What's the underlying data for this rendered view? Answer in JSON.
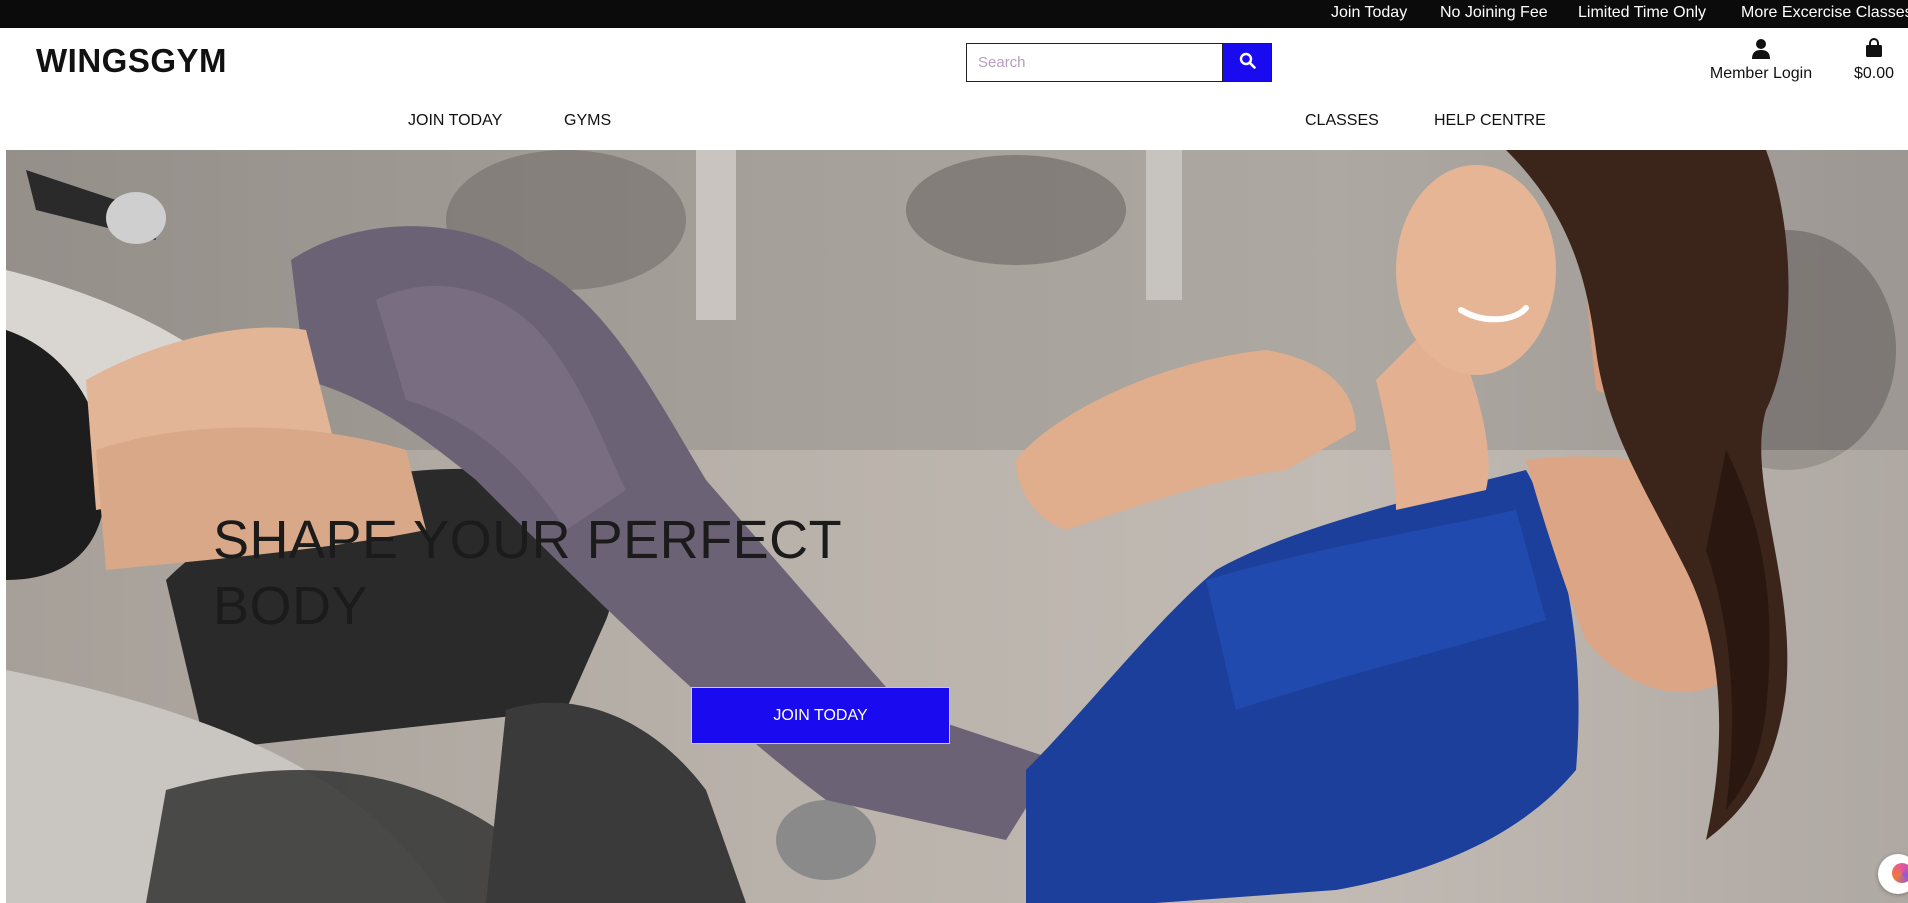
{
  "promo_bar": {
    "items": [
      "Join Today",
      "No Joining Fee",
      "Limited Time Only",
      "More Excercise Classes"
    ]
  },
  "header": {
    "brand": "WINGSGYM",
    "search": {
      "placeholder": "Search",
      "icon": "search-icon"
    },
    "account": {
      "label": "Member Login",
      "icon": "user-icon"
    },
    "bag": {
      "label": "$0.00",
      "icon": "shopping-bag-icon"
    }
  },
  "nav": {
    "items": [
      "JOIN TODAY",
      "GYMS",
      "CLASSES",
      "HELP CENTRE"
    ]
  },
  "hero": {
    "title": "SHAPE YOUR PERFECT BODY",
    "cta": "JOIN TODAY"
  },
  "colors": {
    "accent": "#1a0aef",
    "topbar": "#0b0b0b",
    "text": "#111111"
  }
}
